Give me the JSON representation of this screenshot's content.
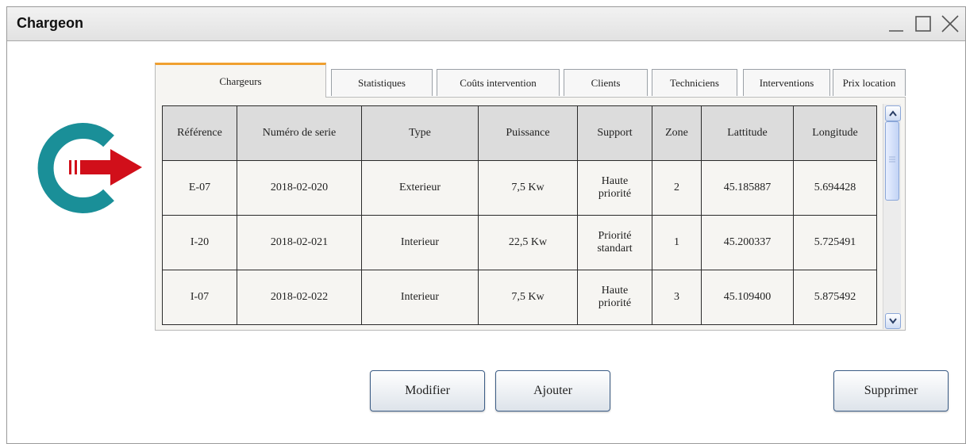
{
  "window": {
    "title": "Chargeon",
    "controls": [
      "minimize-icon",
      "maximize-icon",
      "close-icon"
    ]
  },
  "logo": {
    "icon": "chargeon-logo-icon",
    "colors": {
      "ring": "#1a8f98",
      "arrow": "#d10f1a"
    }
  },
  "tabs": [
    {
      "label": "Chargeurs",
      "active": true
    },
    {
      "label": "Statistiques"
    },
    {
      "label": "Coûts intervention"
    },
    {
      "label": "Clients"
    },
    {
      "label": "Techniciens"
    },
    {
      "label": "Interventions"
    },
    {
      "label": "Prix location"
    }
  ],
  "table": {
    "headers": [
      "Référence",
      "Numéro de serie",
      "Type",
      "Puissance",
      "Support",
      "Zone",
      "Lattitude",
      "Longitude"
    ],
    "rows": [
      [
        "E-07",
        "2018-02-020",
        "Exterieur",
        "7,5 Kw",
        "Haute priorité",
        "2",
        "45.185887",
        "5.694428"
      ],
      [
        "I-20",
        "2018-02-021",
        "Interieur",
        "22,5 Kw",
        "Priorité standart",
        "1",
        "45.200337",
        "5.725491"
      ],
      [
        "I-07",
        "2018-02-022",
        "Interieur",
        "7,5 Kw",
        "Haute priorité",
        "3",
        "45.109400",
        "5.875492"
      ]
    ]
  },
  "buttons": {
    "modifier": "Modifier",
    "ajouter": "Ajouter",
    "supprimer": "Supprimer"
  },
  "colors": {
    "tab_accent": "#f0a030",
    "scrollbar": "#c2d3f5"
  }
}
